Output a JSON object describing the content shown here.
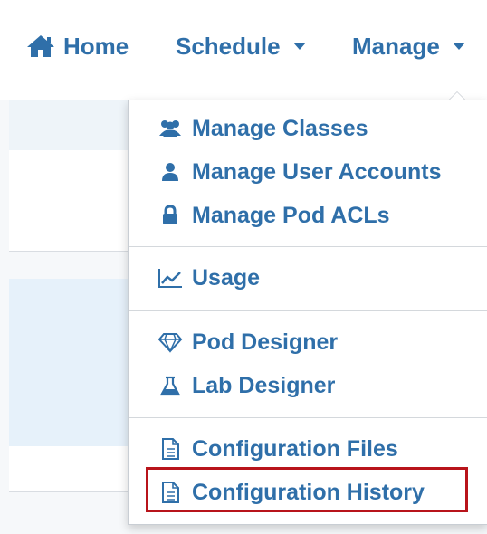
{
  "nav": {
    "home": "Home",
    "schedule": "Schedule",
    "manage": "Manage"
  },
  "menu": {
    "groups": [
      {
        "items": [
          {
            "label": "Manage Classes",
            "icon": "users-icon"
          },
          {
            "label": "Manage User Accounts",
            "icon": "user-icon"
          },
          {
            "label": "Manage Pod ACLs",
            "icon": "lock-icon"
          }
        ]
      },
      {
        "items": [
          {
            "label": "Usage",
            "icon": "line-chart-icon"
          }
        ]
      },
      {
        "items": [
          {
            "label": "Pod Designer",
            "icon": "diamond-icon"
          },
          {
            "label": "Lab Designer",
            "icon": "flask-icon"
          }
        ]
      },
      {
        "items": [
          {
            "label": "Configuration Files",
            "icon": "file-text-icon"
          },
          {
            "label": "Configuration History",
            "icon": "file-text-icon"
          }
        ]
      }
    ]
  },
  "colors": {
    "link": "#2f6fa9",
    "highlight": "#b8141b",
    "background": "#f6f8fa",
    "panel_tint": "#e6f1fa"
  }
}
